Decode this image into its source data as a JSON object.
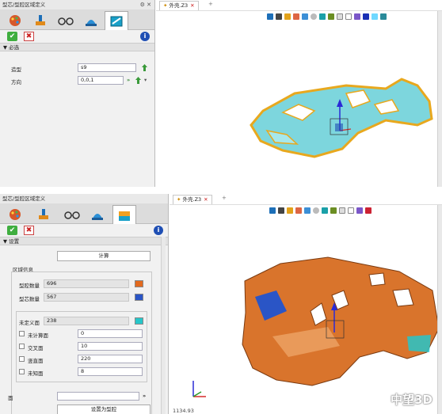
{
  "top": {
    "panel_title": "型芯/型腔区域定义",
    "panel_controls": "⚙ ✕",
    "tabs": [
      "icon-1",
      "icon-2",
      "icon-3",
      "icon-4",
      "icon-5"
    ],
    "section": "必选",
    "fields": [
      {
        "label": "造型",
        "value": "s9"
      },
      {
        "label": "方向",
        "value": "0,0,1"
      }
    ],
    "viewport_tab": "外壳.Z3",
    "viewport_tab_close": "✕",
    "new_tab": "+"
  },
  "bottom": {
    "panel_title": "型芯/型腔区域定义",
    "section": "设置",
    "calc_button": "计算",
    "group_title": "区域信息",
    "counts": [
      {
        "label": "型腔数量",
        "value": "696",
        "color": "#e26a1f"
      },
      {
        "label": "型芯数量",
        "value": "567",
        "color": "#2a55c6"
      }
    ],
    "undefined": {
      "label": "未定义面",
      "value": "238",
      "color": "#26c6c9"
    },
    "face_types": [
      {
        "label": "未计算面",
        "value": "0"
      },
      {
        "label": "交叉面",
        "value": "10"
      },
      {
        "label": "竖直面",
        "value": "220"
      },
      {
        "label": "未知面",
        "value": "8"
      }
    ],
    "face_label": "面",
    "set_button": "设置为型腔",
    "viewport_tab": "外壳.Z3",
    "viewport_tab_close": "✕",
    "new_tab": "+",
    "coords": "1134.93",
    "brand": "中望3D"
  },
  "colors": {
    "accent": "#1f4fb4",
    "cavity": "#e26a1f",
    "core": "#2a55c6",
    "undefined": "#26c6c9",
    "model_yellow": "#e8a81e"
  }
}
